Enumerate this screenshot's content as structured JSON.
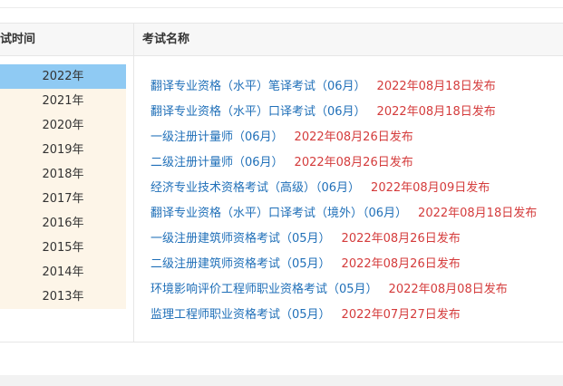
{
  "header": {
    "year_label": "考试时间",
    "name_label": "考试名称"
  },
  "years": [
    {
      "label": "2022年",
      "active": true
    },
    {
      "label": "2021年"
    },
    {
      "label": "2020年"
    },
    {
      "label": "2019年"
    },
    {
      "label": "2018年"
    },
    {
      "label": "2017年"
    },
    {
      "label": "2016年"
    },
    {
      "label": "2015年"
    },
    {
      "label": "2014年"
    },
    {
      "label": "2013年"
    }
  ],
  "exams": [
    {
      "name": "翻译专业资格（水平）笔译考试（06月）",
      "date": "2022年08月18日发布"
    },
    {
      "name": "翻译专业资格（水平）口译考试（06月）",
      "date": "2022年08月18日发布"
    },
    {
      "name": "一级注册计量师（06月）",
      "date": "2022年08月26日发布"
    },
    {
      "name": "二级注册计量师（06月）",
      "date": "2022年08月26日发布"
    },
    {
      "name": "经济专业技术资格考试（高级）（06月）",
      "date": "2022年08月09日发布"
    },
    {
      "name": "翻译专业资格（水平）口译考试（境外）（06月）",
      "date": "2022年08月18日发布"
    },
    {
      "name": "一级注册建筑师资格考试（05月）",
      "date": "2022年08月26日发布"
    },
    {
      "name": "二级注册建筑师资格考试（05月）",
      "date": "2022年08月26日发布"
    },
    {
      "name": "环境影响评价工程师职业资格考试（05月）",
      "date": "2022年08月08日发布"
    },
    {
      "name": "监理工程师职业资格考试（05月）",
      "date": "2022年07月27日发布"
    }
  ],
  "colors": {
    "link": "#1f6fb8",
    "date": "#d43b3b",
    "active_year": "#8fcaf3",
    "year_bg": "#fdf5e8"
  }
}
